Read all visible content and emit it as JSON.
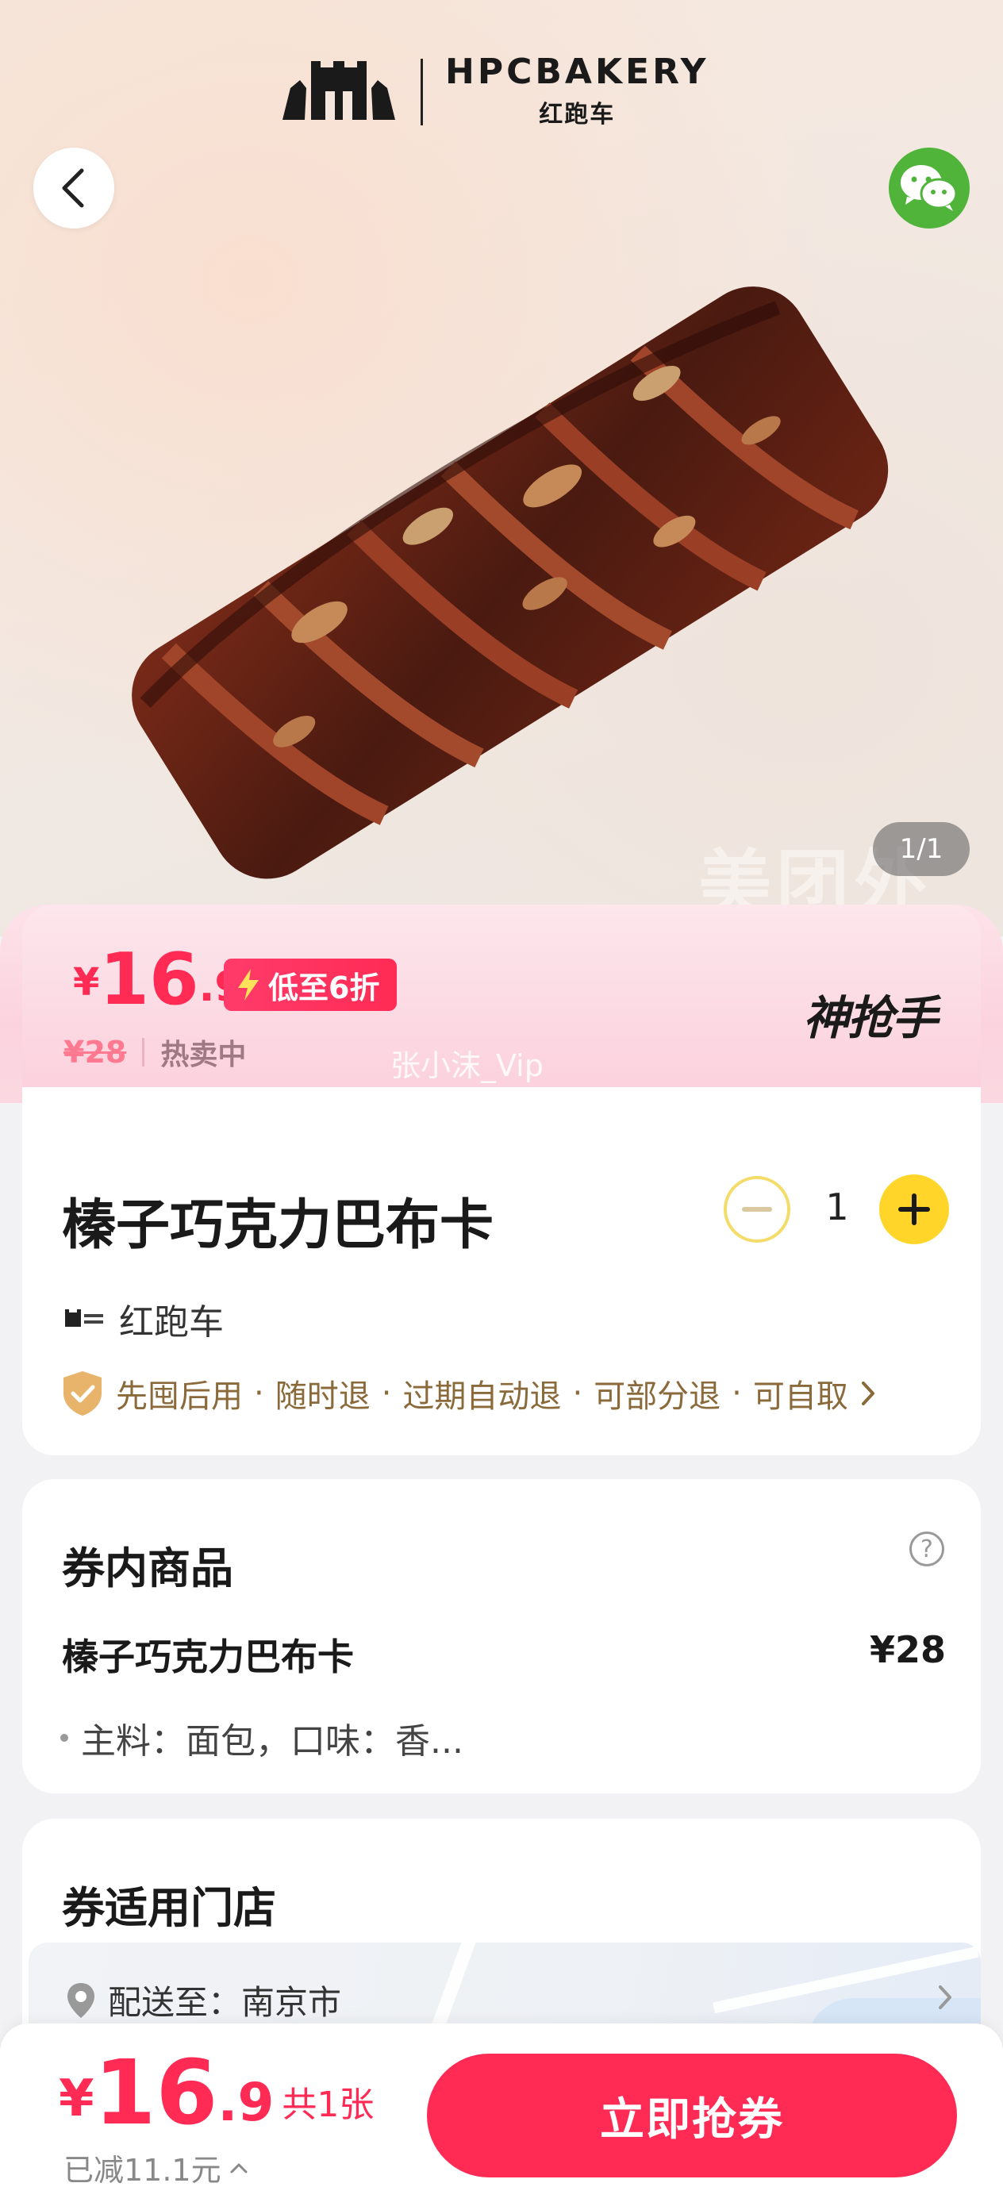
{
  "brand": {
    "name": "HPCBAKERY",
    "sub": "红跑车"
  },
  "gallery": {
    "counter": "1/1",
    "watermark": "美团外"
  },
  "price_banner": {
    "currency": "¥",
    "price_int": "16",
    "price_dec": ".9",
    "discount_label": "低至6折",
    "original_price": "¥28",
    "status": "热卖中",
    "user_watermark": "张小沫_Vip",
    "badge": "神抢手"
  },
  "product": {
    "title": "榛子巧克力巴布卡",
    "quantity": "1",
    "shop_name": "红跑车",
    "guarantees": [
      "先囤后用",
      "随时退",
      "过期自动退",
      "可部分退",
      "可自取"
    ]
  },
  "items_section": {
    "title": "券内商品",
    "help": "?",
    "item_name": "榛子巧克力巴布卡",
    "item_price": "¥28",
    "item_desc": "主料：面包，口味：香..."
  },
  "stores_section": {
    "title": "券适用门店",
    "deliver_to": "配送至：南京市"
  },
  "bottom_bar": {
    "currency": "¥",
    "price_int": "16",
    "price_dec": ".9",
    "count": "共1张",
    "saved": "已减11.1元",
    "buy_label": "立即抢券"
  },
  "colors": {
    "accent": "#ff2b55",
    "plus_button": "#ffd52a",
    "wechat": "#50b43a",
    "guarantee_text": "#8a6a3a"
  },
  "icons": {
    "back": "chevron-left-icon",
    "share": "wechat-icon",
    "discount": "lightning-icon",
    "minus": "minus-icon",
    "plus": "plus-icon",
    "guarantee": "shield-check-icon",
    "more": "chevron-right-icon",
    "help": "question-icon",
    "location": "location-pin-icon",
    "expand": "chevron-up-icon"
  }
}
